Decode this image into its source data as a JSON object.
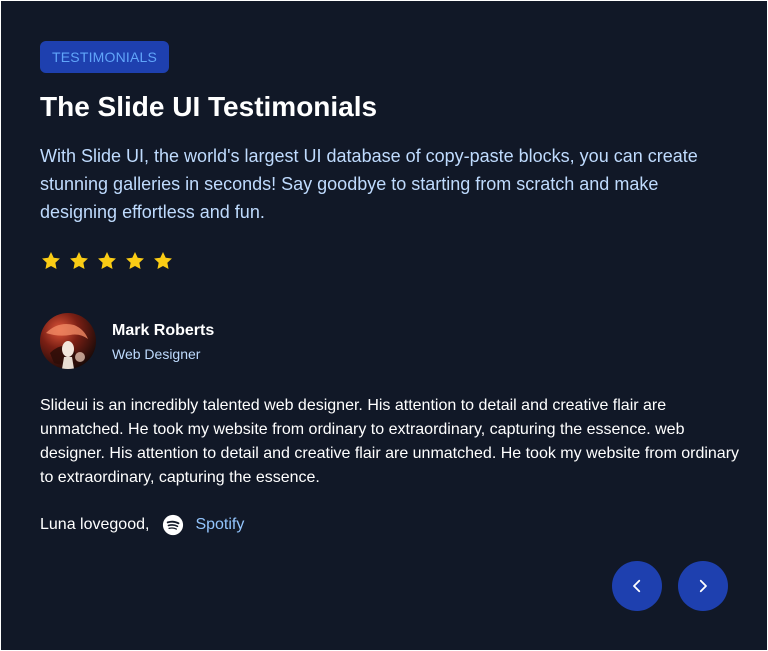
{
  "badge": "TESTIMONIALS",
  "title": "The Slide UI Testimonials",
  "description": "With Slide UI, the world's largest UI database of copy-paste blocks, you can create stunning galleries in seconds! Say goodbye to starting from scratch and make designing effortless and fun.",
  "rating": {
    "value": 5,
    "max": 5,
    "star_color": "#facc15"
  },
  "author": {
    "name": "Mark Roberts",
    "role": "Web Designer"
  },
  "quote": "Slideui is an incredibly talented web designer. His attention to detail and creative flair are unmatched. He took my website from ordinary to extraordinary, capturing the essence. web designer. His attention to detail and creative flair are unmatched. He took my website from ordinary to extraordinary, capturing the essence.",
  "credit": {
    "name": "Luna lovegood,",
    "company": "Spotify",
    "company_icon": "spotify-icon"
  },
  "nav": {
    "prev_icon": "chevron-left-icon",
    "next_icon": "chevron-right-icon"
  },
  "colors": {
    "background": "#111827",
    "accent": "#1e40af",
    "badge_text": "#60a5fa",
    "body_text": "#bfdbfe"
  }
}
